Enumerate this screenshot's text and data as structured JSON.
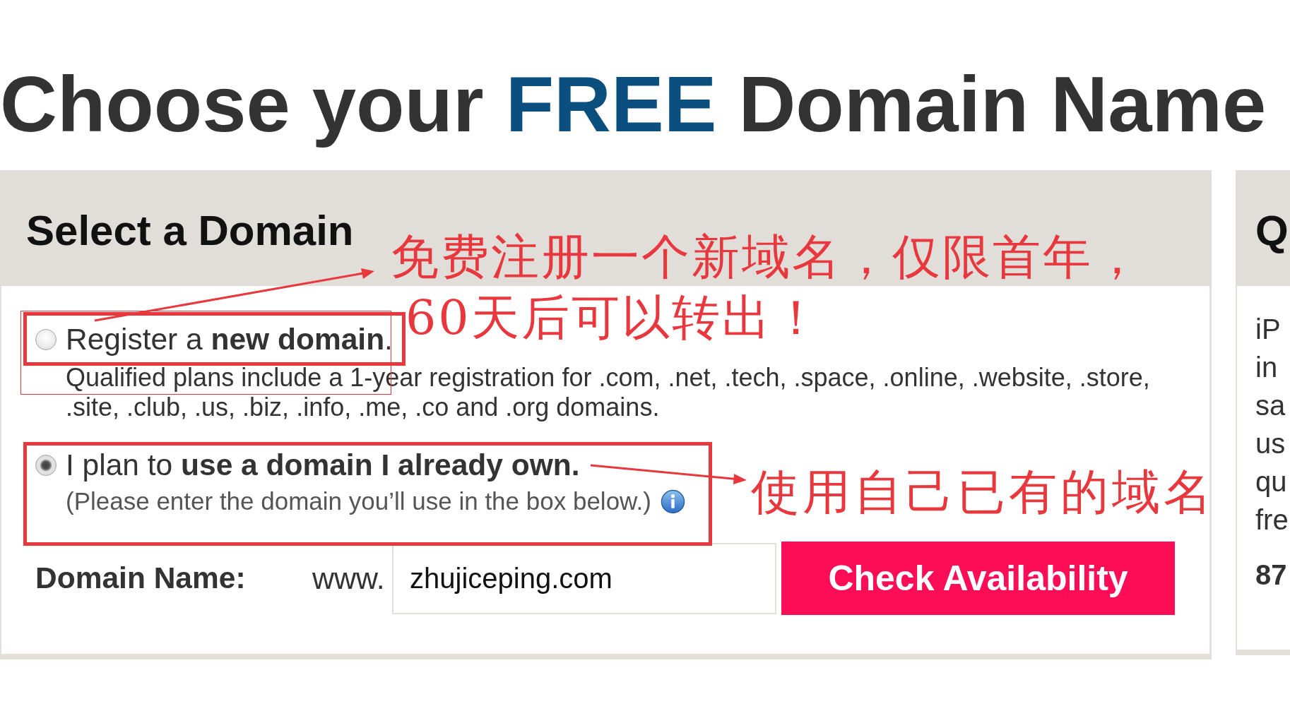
{
  "heading": {
    "segments": [
      {
        "text": "Choose your ",
        "kind": "plain"
      },
      {
        "text": "FREE",
        "kind": "accent"
      },
      {
        "text": " Domain Name",
        "kind": "plain"
      }
    ]
  },
  "domain_panel": {
    "title": "Select a Domain",
    "options": [
      {
        "label": "Register a **new domain**.",
        "description": {
          "text": "Qualified plans include a 1-year registration for .com, .net, .tech, .space, .online, .website, .store, .site, .club, .us, .biz, .info, .me, .co and .org domains.",
          "kind": "detail"
        },
        "info_icon": false,
        "selected": false
      },
      {
        "label": "I plan to **use a domain I already own.**",
        "description": {
          "text": "(Please enter the domain you’ll use in the box below.)",
          "kind": "hint"
        },
        "info_icon": true,
        "selected": true
      }
    ],
    "domain_field": {
      "label": "Domain Name:",
      "prefix": "www.",
      "value": "zhujiceping.com"
    },
    "button": "Check Availability"
  },
  "side_panel": {
    "title": "Q",
    "lines": [
      "iP",
      "in",
      "sa",
      "us",
      "qu",
      "fre"
    ],
    "highlight": "87"
  },
  "annotations": {
    "register_note": [
      "免费注册一个新域名，仅限首年，",
      "60天后可以转出！"
    ],
    "own_note": "使用自己已有的域名"
  }
}
